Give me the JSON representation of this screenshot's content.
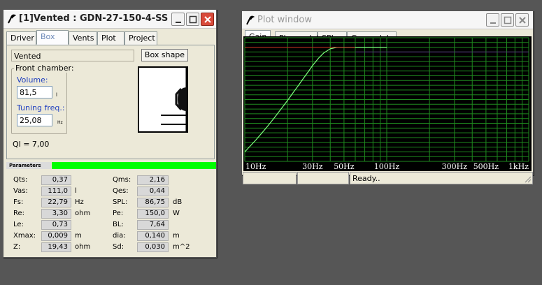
{
  "main_window": {
    "title": "[1]Vented : GDN-27-150-4-SS",
    "tabs": [
      "Driver",
      "Box",
      "Vents",
      "Plot",
      "Project"
    ],
    "active_tab": "Box",
    "box_type": "Vented",
    "box_shape_label": "Box shape",
    "front_chamber_label": "Front chamber:",
    "volume_label": "Volume:",
    "volume_value": "81,5",
    "volume_unit": "l",
    "tuning_label": "Tuning freq.:",
    "tuning_value": "25,08",
    "tuning_unit": "Hz",
    "ql_text": "Ql = 7,00",
    "parameters_label": "Parameters",
    "params_left": [
      {
        "label": "Qts:",
        "value": "0,37",
        "unit": ""
      },
      {
        "label": "Vas:",
        "value": "111,0",
        "unit": "l"
      },
      {
        "label": "Fs:",
        "value": "22,79",
        "unit": "Hz"
      },
      {
        "label": "Re:",
        "value": "3,30",
        "unit": "ohm"
      },
      {
        "label": "Le:",
        "value": "0,73",
        "unit": ""
      },
      {
        "label": "Xmax:",
        "value": "0,009",
        "unit": "m"
      },
      {
        "label": "Z:",
        "value": "19,43",
        "unit": "ohm"
      }
    ],
    "params_right": [
      {
        "label": "Qms:",
        "value": "2,16",
        "unit": ""
      },
      {
        "label": "Qes:",
        "value": "0,44",
        "unit": ""
      },
      {
        "label": "SPL:",
        "value": "86,75",
        "unit": "dB"
      },
      {
        "label": "Pe:",
        "value": "150,0",
        "unit": "W"
      },
      {
        "label": "BL:",
        "value": "7,64",
        "unit": ""
      },
      {
        "label": "dia:",
        "value": "0,140",
        "unit": "m"
      },
      {
        "label": "Sd:",
        "value": "0,030",
        "unit": "m^2"
      }
    ]
  },
  "plot_window": {
    "title": "Plot window",
    "tabs": [
      "Gain",
      "Phase plot",
      "SPL",
      "Group delay"
    ],
    "active_tab": "Gain",
    "status_text": "Ready..",
    "colors": {
      "background": "#000000",
      "grid": "#1f8a1f",
      "curve": "#7dff7d",
      "reference": "#c81e1e",
      "labels": "#ffffff"
    }
  },
  "chart_data": {
    "type": "line",
    "x_scale": "log",
    "xlim": [
      10,
      1000
    ],
    "x_ticks": [
      {
        "value": 10,
        "label": "10Hz"
      },
      {
        "value": 30,
        "label": "30Hz"
      },
      {
        "value": 50,
        "label": "50Hz"
      },
      {
        "value": 100,
        "label": "100Hz"
      },
      {
        "value": 300,
        "label": "300Hz"
      },
      {
        "value": 500,
        "label": "500Hz"
      },
      {
        "value": 1000,
        "label": "1kHz"
      }
    ],
    "ylim": [
      -36,
      3
    ],
    "grid": true,
    "series": [
      {
        "color": "#7dff7d",
        "x": [
          10,
          12,
          14,
          16,
          18,
          20,
          22,
          24,
          26,
          28,
          30,
          33,
          36,
          40,
          45,
          50,
          60,
          80,
          100
        ],
        "y": [
          -33,
          -29.2,
          -25.7,
          -22.5,
          -19.5,
          -16.8,
          -14.2,
          -11.9,
          -9.7,
          -7.7,
          -5.8,
          -3.5,
          -1.8,
          -0.5,
          0,
          0,
          0,
          0,
          0
        ]
      },
      {
        "color": "#c81e1e",
        "x": [
          10,
          60
        ],
        "y": [
          0,
          0
        ]
      },
      {
        "color": "#5a2a8a",
        "x": [
          60,
          1000
        ],
        "y": [
          -1.5,
          -1.5
        ]
      }
    ]
  }
}
